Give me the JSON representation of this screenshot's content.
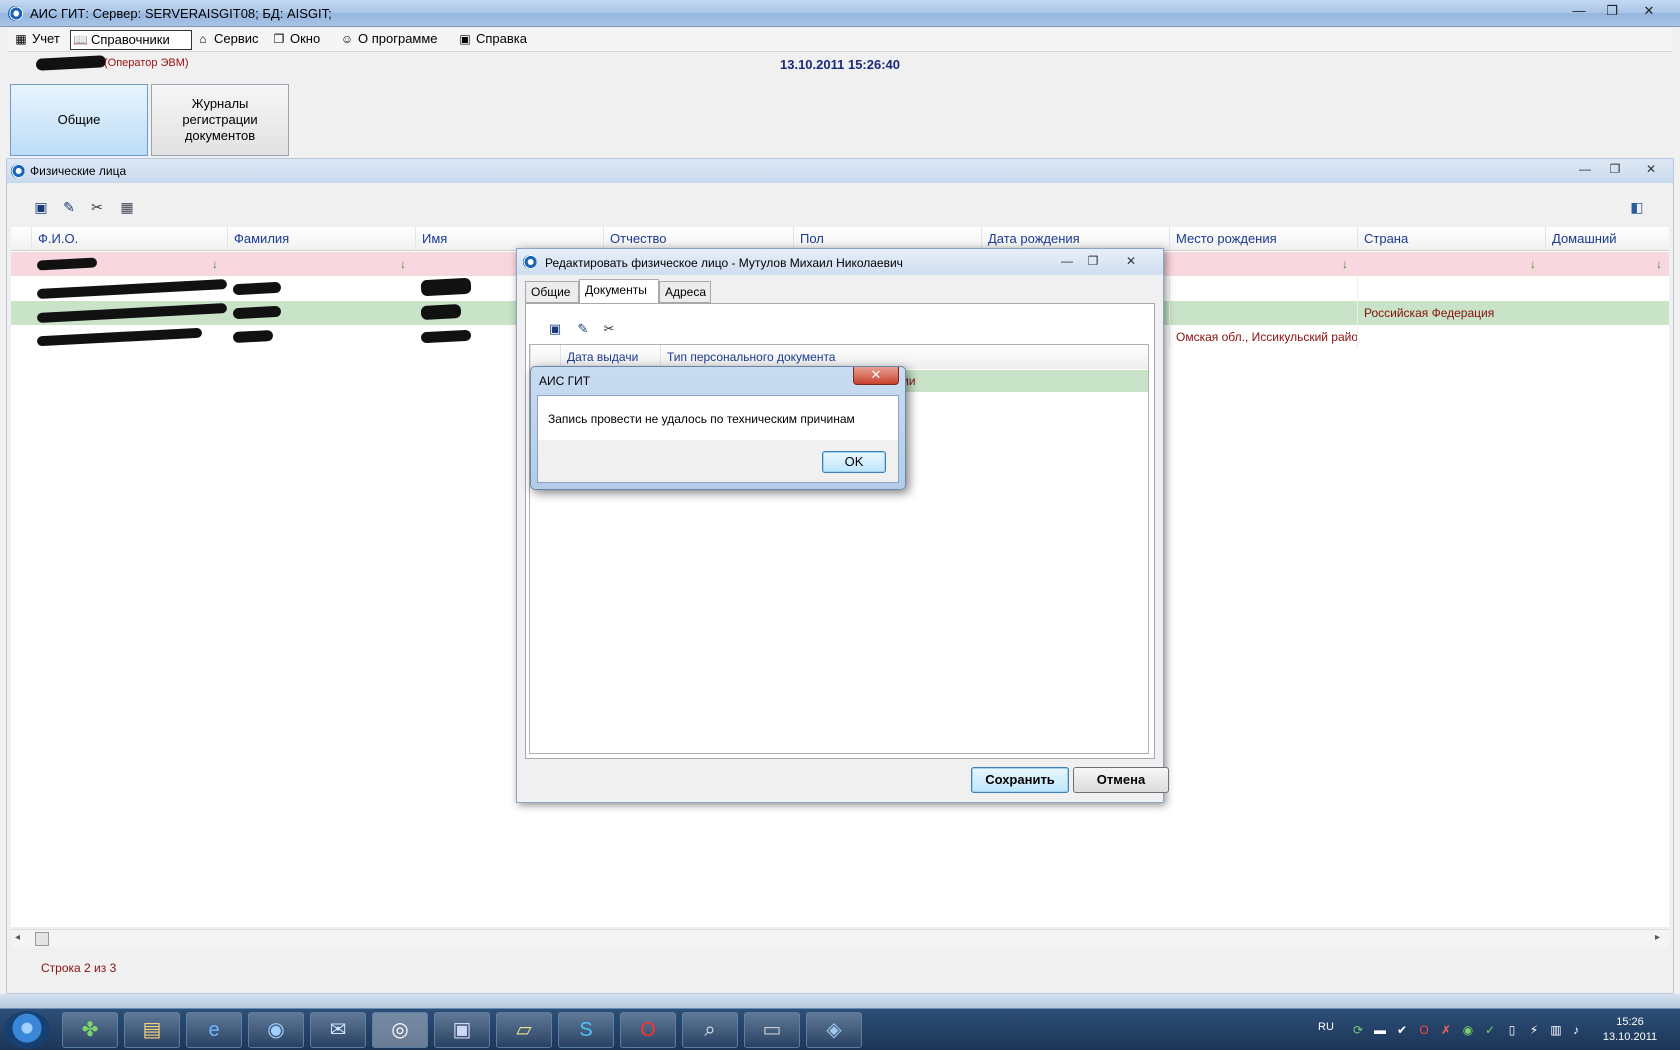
{
  "app": {
    "title": "АИС ГИТ:  Сервер: SERVERAISGIT08;   БД: AISGIT;",
    "minimize": "—",
    "restore": "❐",
    "close": "✕"
  },
  "menu": [
    {
      "label": "Учет",
      "icon": "ledger-icon",
      "glyph": "▦"
    },
    {
      "label": "Справочники",
      "icon": "book-icon",
      "glyph": "📖"
    },
    {
      "label": "Сервис",
      "icon": "house-icon",
      "glyph": "⌂"
    },
    {
      "label": "Окно",
      "icon": "windows-icon",
      "glyph": "❐"
    },
    {
      "label": "О программе",
      "icon": "smiley-icon",
      "glyph": "☺"
    },
    {
      "label": "Справка",
      "icon": "help-book-icon",
      "glyph": "▣"
    }
  ],
  "info": {
    "operator": "(Оператор ЭВМ)",
    "datetime": "13.10.2011  15:26:40"
  },
  "bigtabs": {
    "general": "Общие",
    "journals": "Журналы регистрации документов"
  },
  "child": {
    "title": "Физические лица",
    "minimize": "—",
    "restore": "❐",
    "close": "✕",
    "columns": [
      "Ф.И.О.",
      "Фамилия",
      "Имя",
      "Отчество",
      "Пол",
      "Дата рождения",
      "Место рождения",
      "Страна",
      "Домашний"
    ],
    "rows": [
      {
        "place": "",
        "country": ""
      },
      {
        "place": "",
        "country": "Российская Федерация"
      },
      {
        "place": "Омская обл., Иссикульский райо",
        "country": ""
      }
    ],
    "status": "Строка 2 из 3"
  },
  "dialog": {
    "title": "Редактировать физическое лицо - Мутулов Михаил Николаевич",
    "tabs": [
      "Общие",
      "Документы",
      "Адреса"
    ],
    "columns": [
      "Дата выдачи",
      "Тип персонального документа"
    ],
    "row": {
      "doc_type": "Паспорт гражданина Российской Федерации"
    },
    "save": "Сохранить",
    "cancel": "Отмена"
  },
  "msgbox": {
    "title": "АИС ГИТ",
    "text": "Запись провести не удалось по техническим причинам",
    "ok": "OK"
  },
  "taskbar": {
    "lang": "RU",
    "time": "15:26",
    "date": "13.10.2011"
  },
  "colors": {
    "header_text": "#1a3a90",
    "cell_text": "#8a1010",
    "filter_row": "#f8d7de",
    "selected_row": "#c8e3c8"
  }
}
